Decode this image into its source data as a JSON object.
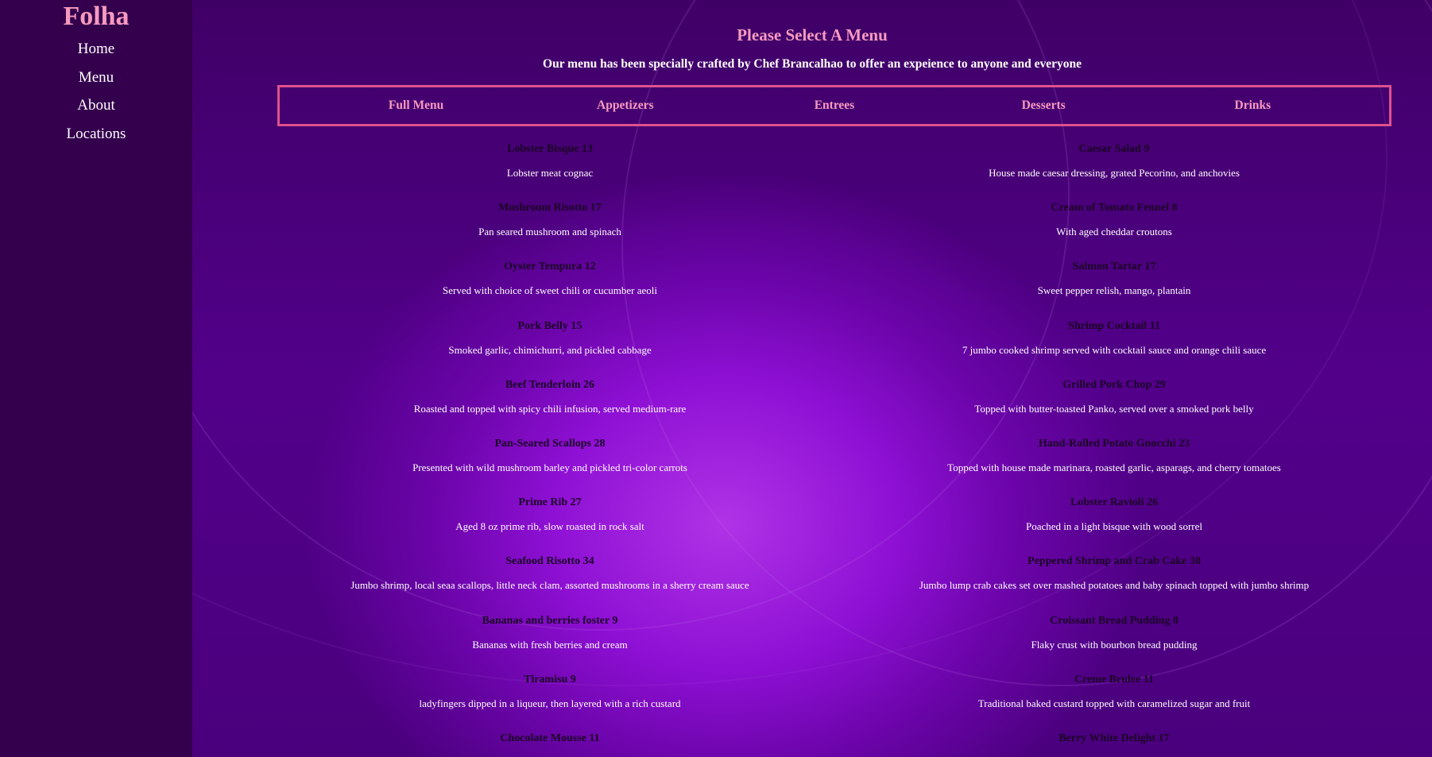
{
  "brand": "Folha",
  "nav": [
    "Home",
    "Menu",
    "About",
    "Locations"
  ],
  "header": {
    "title": "Please Select A Menu",
    "subtitle": "Our menu has been specially crafted by Chef Brancalhao to offer an expeience to anyone and everyone"
  },
  "tabs": [
    "Full Menu",
    "Appetizers",
    "Entrees",
    "Desserts",
    "Drinks"
  ],
  "menu_left": [
    {
      "name": "Lobster Bisque 13",
      "desc": "Lobster meat cognac"
    },
    {
      "name": "Mushroom Risotto 17",
      "desc": "Pan seared mushroom and spinach"
    },
    {
      "name": "Oyster Tempura 12",
      "desc": "Served with choice of sweet chili or cucumber aeoli"
    },
    {
      "name": "Pork Belly 15",
      "desc": "Smoked garlic, chimichurri, and pickled cabbage"
    },
    {
      "name": "Beef Tenderloin 26",
      "desc": "Roasted and topped with spicy chili infusion, served medium-rare"
    },
    {
      "name": "Pan-Seared Scallops 28",
      "desc": "Presented with wild mushroom barley and pickled tri-color carrots"
    },
    {
      "name": "Prime Rib 27",
      "desc": "Aged 8 oz prime rib, slow roasted in rock salt"
    },
    {
      "name": "Seafood Risotto 34",
      "desc": "Jumbo shrimp, local seaa scallops, little neck clam, assorted mushrooms in a sherry cream sauce"
    },
    {
      "name": "Bananas and berries foster 9",
      "desc": "Bananas with fresh berries and cream"
    },
    {
      "name": "Tiramisu 9",
      "desc": "ladyfingers dipped in a liqueur, then layered with a rich custard"
    },
    {
      "name": "Chocolate Mousse 11",
      "desc": ""
    }
  ],
  "menu_right": [
    {
      "name": "Caesar Salad 9",
      "desc": "House made caesar dressing, grated Pecorino, and anchovies"
    },
    {
      "name": "Cream of Tomato Fennel 8",
      "desc": "With aged cheddar croutons"
    },
    {
      "name": "Salmon Tartar 17",
      "desc": "Sweet pepper relish, mango, plantain"
    },
    {
      "name": "Shrimp Cocktail 11",
      "desc": "7 jumbo cooked shrimp served with cocktail sauce and orange chili sauce"
    },
    {
      "name": "Grilled Pork Chop 29",
      "desc": "Topped with butter-toasted Panko, served over a smoked pork belly"
    },
    {
      "name": "Hand-Rolled Potato Gnocchi 23",
      "desc": "Topped with house made marinara, roasted garlic, asparags, and cherry tomatoes"
    },
    {
      "name": "Lobster Ravioli 26",
      "desc": "Poached in a light bisque with wood sorrel"
    },
    {
      "name": "Peppered Shrimp and Crab Cake 30",
      "desc": "Jumbo lump crab cakes set over mashed potatoes and baby spinach topped with jumbo shrimp"
    },
    {
      "name": "Croissant Bread Pudding 8",
      "desc": "Flaky crust with bourbon bread pudding"
    },
    {
      "name": "Creme Brulee 11",
      "desc": "Traditional baked custard topped with caramelized sugar and fruit"
    },
    {
      "name": "Berry White Delight 17",
      "desc": ""
    }
  ],
  "colors": {
    "accent_pink": "#f79ac0",
    "tab_border": "#e0508e",
    "sidebar_bg": "#34004d",
    "item_name": "#1a0024"
  }
}
